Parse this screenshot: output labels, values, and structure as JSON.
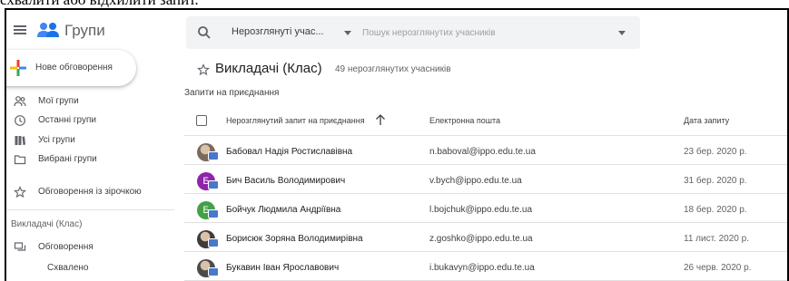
{
  "caption": "схвалити або відхилити запит.",
  "app": {
    "title": "Групи"
  },
  "search": {
    "filter_value": "Нерозглянуті учас...",
    "placeholder": "Пошук нерозглянутих учасників"
  },
  "sidebar": {
    "new_conversation": "Нове обговорення",
    "items": [
      {
        "label": "Мої групи",
        "icon": "people-icon"
      },
      {
        "label": "Останні групи",
        "icon": "clock-icon"
      },
      {
        "label": "Усі групи",
        "icon": "library-icon"
      },
      {
        "label": "Вибрані групи",
        "icon": "folder-star-icon"
      },
      {
        "label": "Обговорення із зірочкою",
        "icon": "star-icon"
      }
    ],
    "section": "Викладачі (Клас)",
    "section_items": [
      {
        "label": "Обговорення",
        "icon": "forum-icon"
      }
    ],
    "sub_item": "Схвалено"
  },
  "main": {
    "title": "Викладачі (Клас)",
    "count": "49 нерозглянутих учасників",
    "section": "Запити на приєднання",
    "columns": {
      "name": "Нерозглянутий запит на приєднання",
      "email": "Електронна пошта",
      "date": "Дата запиту"
    },
    "rows": [
      {
        "name": "Бабовал Надія Ростиславівна",
        "email": "n.baboval@ippo.edu.te.ua",
        "date": "23 бер. 2020 р.",
        "avatar": "photo",
        "initial": "",
        "color": "#7a6a5a"
      },
      {
        "name": "Бич Василь Володимирович",
        "email": "v.bych@ippo.edu.te.ua",
        "date": "31 бер. 2020 р.",
        "avatar": "letter",
        "initial": "Б",
        "color": "#8e24aa"
      },
      {
        "name": "Бойчук Людмила Андріївна",
        "email": "l.bojchuk@ippo.edu.te.ua",
        "date": "18 бер. 2020 р.",
        "avatar": "letter",
        "initial": "Б",
        "color": "#43a047"
      },
      {
        "name": "Борисюк Зоряна Володимирівна",
        "email": "z.goshko@ippo.edu.te.ua",
        "date": "11 лист. 2020 р.",
        "avatar": "photo",
        "initial": "",
        "color": "#3c3c3c"
      },
      {
        "name": "Букавин Іван Ярославович",
        "email": "i.bukavyn@ippo.edu.te.ua",
        "date": "26 черв. 2020 р.",
        "avatar": "photo",
        "initial": "",
        "color": "#4a4a4a"
      }
    ]
  },
  "colors": {
    "plus_blue": "#4285f4",
    "plus_red": "#ea4335",
    "plus_yellow": "#fbbc04",
    "plus_green": "#34a853",
    "logo_blue": "#4285f4",
    "badge": "#4a78c8"
  }
}
